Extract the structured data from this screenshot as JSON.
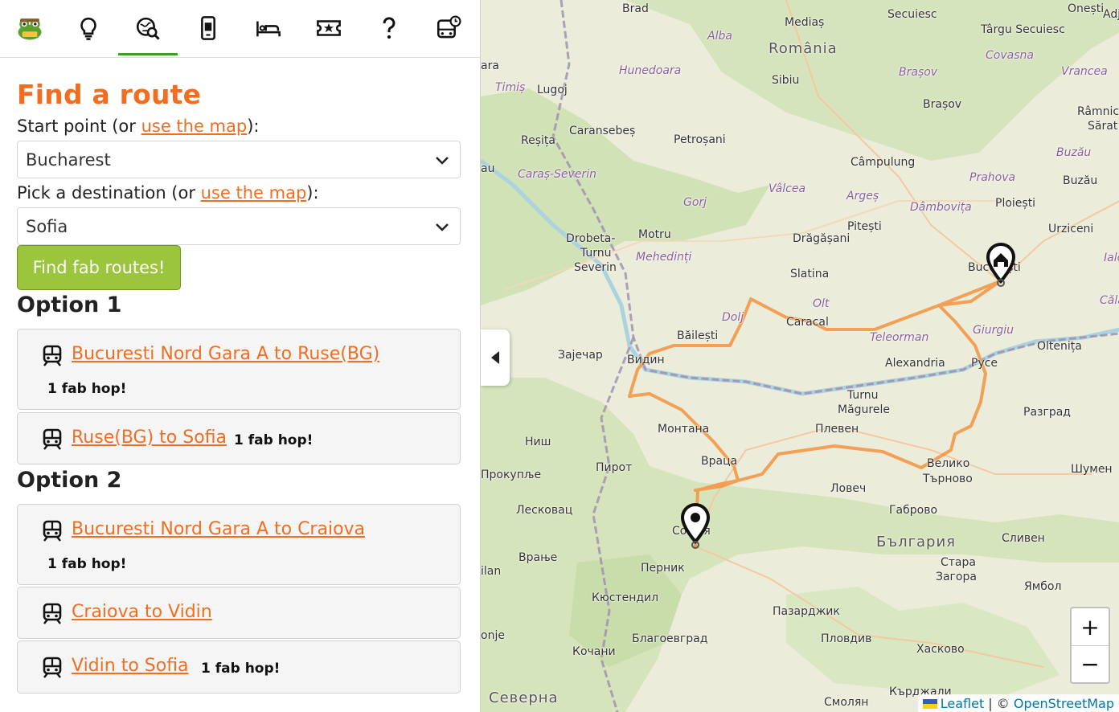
{
  "nav": {
    "items": [
      {
        "name": "logo",
        "active": false
      },
      {
        "name": "lightbulb-icon",
        "active": false
      },
      {
        "name": "route-search-icon",
        "active": true
      },
      {
        "name": "phone-icon",
        "active": false
      },
      {
        "name": "bed-icon",
        "active": false
      },
      {
        "name": "ticket-star-icon",
        "active": false
      },
      {
        "name": "question-icon",
        "active": false
      },
      {
        "name": "bus-clock-icon",
        "active": false
      }
    ]
  },
  "form": {
    "title": "Find a route",
    "start_label_prefix": "Start point (or ",
    "start_label_link": "use the map",
    "start_label_suffix": "):",
    "start_value": "Bucharest",
    "dest_label_prefix": "Pick a destination (or ",
    "dest_label_link": "use the map",
    "dest_label_suffix": "):",
    "dest_value": "Sofia",
    "submit_label": "Find fab routes!"
  },
  "options": [
    {
      "heading": "Option 1",
      "legs": [
        {
          "label": "Bucuresti Nord Gara A to Ruse(BG)",
          "note": "1 fab hop!"
        },
        {
          "label": "Ruse(BG) to Sofia ",
          "note": "1 fab hop!"
        }
      ]
    },
    {
      "heading": "Option 2",
      "legs": [
        {
          "label": "Bucuresti Nord Gara A to Craiova",
          "note": "1 fab hop!"
        },
        {
          "label": "Craiova to Vidin",
          "note": ""
        },
        {
          "label": "Vidin to Sofia ",
          "note": "1 fab hop!"
        }
      ]
    }
  ],
  "map": {
    "labels": {
      "brad": "Brad",
      "medias": "Mediaș",
      "romania": "România",
      "alba": "Alba",
      "sibiu": "Sibiu",
      "secuiesc": "Secuiesc",
      "targu_secuiesc": "Târgu Secuiesc",
      "covasna": "Covasna",
      "onesti": "Onești",
      "adj": "Adj",
      "vrancea": "Vrancea",
      "ramnic": "Râmnic",
      "sarat": "Sărat",
      "brasov_region": "Brașov",
      "brasov": "Brașov",
      "hunedoara": "Hunedoara",
      "timis": "Timiș",
      "lugoj": "Lugoj",
      "ara": "ara",
      "caransebes": "Caransebeș",
      "resita": "Reșița",
      "petrosani": "Petroșani",
      "caras": "Caraș-Severin",
      "au": "au",
      "gorj": "Gorj",
      "valcea": "Vâlcea",
      "arges": "Argeș",
      "campulung": "Câmpulung",
      "dambovita": "Dâmbovița",
      "prahova": "Prahova",
      "buzau_region": "Buzău",
      "buzau": "Buzău",
      "ploiesti": "Ploiești",
      "urziceni": "Urziceni",
      "drobeta1": "Drobeta-",
      "drobeta2": "Turnu",
      "drobeta3": "Severin",
      "motru": "Motru",
      "mehedinti": "Mehedinți",
      "dragasani": "Drăgășani",
      "pitesti": "Pitești",
      "slatina": "Slatina",
      "bucuresti": "București",
      "ialo": "Ialo",
      "calar": "Călăr",
      "olt": "Olt",
      "caracal": "Caracal",
      "dolj": "Dolj",
      "bailesti": "Băilești",
      "teleorman": "Teleorman",
      "giurgiu": "Giurgiu",
      "oltenita": "Oltenița",
      "zajecar": "Зајечар",
      "vidin": "Видин",
      "alexandria": "Alexandria",
      "ruse": "Русе",
      "turnu1": "Turnu",
      "turnu2": "Măgurele",
      "montana": "Монтана",
      "pleven": "Плевен",
      "razgrad": "Разград",
      "nish": "Ниш",
      "pirot": "Пирот",
      "vratsa": "Враца",
      "veliko1": "Велико",
      "veliko2": "Търново",
      "shumen": "Шумен",
      "prokuplje": "Прокупље",
      "lovech": "Ловеч",
      "leskovac": "Лесковац",
      "gabrovo": "Габрово",
      "sofia": "София",
      "bulgaria": "България",
      "sliven": "Сливен",
      "vranje": "Врање",
      "pernik": "Перник",
      "stara1": "Стара",
      "stara2": "Загора",
      "yambol": "Ямбол",
      "ilan": "ilan",
      "kyustendil": "Кюстендил",
      "pazardzhik": "Пазарджик",
      "onje": "onje",
      "blagoevgrad": "Благоевград",
      "plovdiv": "Пловдив",
      "haskovo": "Хасково",
      "kochani": "Кочани",
      "severna": "Северна",
      "kardzhali": "Кърджали",
      "smolyan": "Смолян"
    },
    "zoom_in": "+",
    "zoom_out": "−",
    "attribution_leaflet": "Leaflet",
    "attribution_sep": " | © ",
    "attribution_osm": "OpenStreetMap",
    "colors": {
      "route": "#f5923e",
      "land": "#ebecd9",
      "forest": "#cfe2b3",
      "river": "#aad3df",
      "border": "#9e8cb0"
    }
  }
}
